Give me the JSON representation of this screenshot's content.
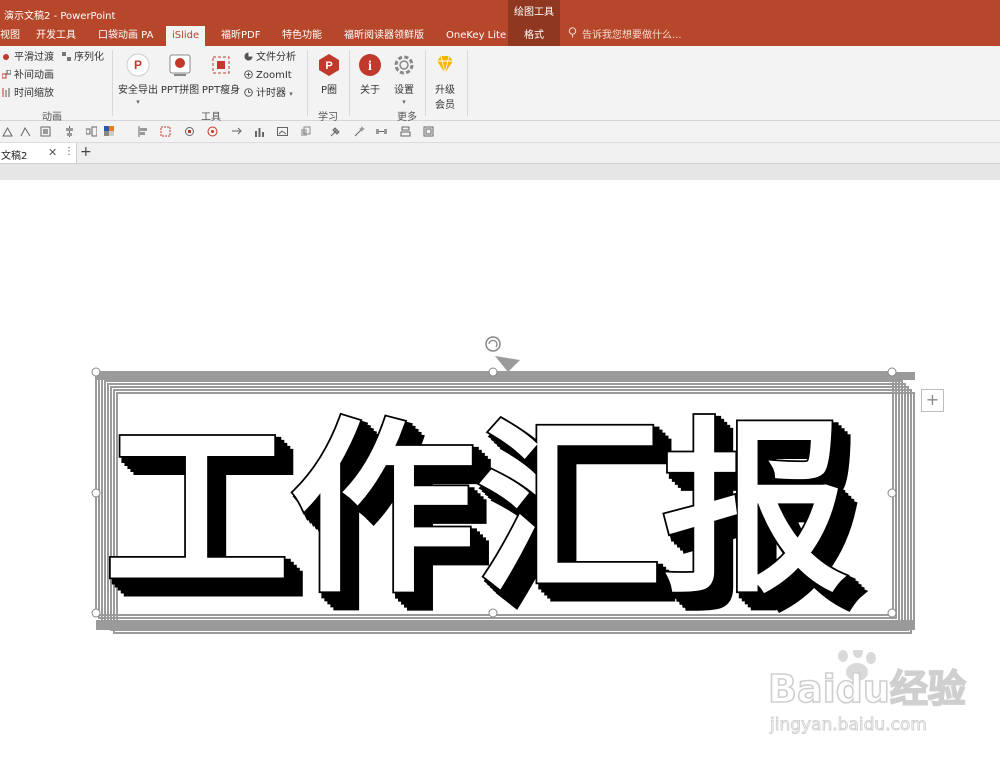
{
  "window": {
    "title": "演示文稿2 - PowerPoint",
    "context_group": "绘图工具"
  },
  "tabs": [
    {
      "label": "视图",
      "active": false
    },
    {
      "label": "开发工具",
      "active": false
    },
    {
      "label": "口袋动画 PA",
      "active": false
    },
    {
      "label": "iSlide",
      "active": true
    },
    {
      "label": "福昕PDF",
      "active": false
    },
    {
      "label": "特色功能",
      "active": false
    },
    {
      "label": "福昕阅读器领鲜版",
      "active": false
    },
    {
      "label": "OneKey Lite",
      "active": false
    },
    {
      "label": "格式",
      "active": false
    }
  ],
  "tell_me": "告诉我您想要做什么...",
  "ribbon": {
    "animation": {
      "items": [
        "平滑过渡",
        "序列化",
        "补间动画",
        "时间缩放"
      ],
      "label": "动画"
    },
    "tools": {
      "big": [
        "安全导出",
        "PPT拼图",
        "PPT瘦身"
      ],
      "small": [
        "文件分析",
        "ZoomIt",
        "计时器"
      ],
      "label": "工具"
    },
    "learn": {
      "big": [
        "P圈"
      ],
      "label": "学习"
    },
    "more": {
      "big": [
        "关于",
        "设置"
      ],
      "label": "更多"
    },
    "upgrade": {
      "line1": "升级",
      "line2": "会员"
    }
  },
  "doc_tab": {
    "name": "文稿2",
    "add": "+"
  },
  "slide": {
    "headline": "工作汇报"
  },
  "watermark": {
    "brand": "Baidu经验",
    "url": "jingyan.baidu.com"
  },
  "colors": {
    "accent": "#b7472a",
    "accent_dark": "#8f3721",
    "ribbon_bg": "#f3f3f3",
    "selection_gray": "#999999"
  }
}
